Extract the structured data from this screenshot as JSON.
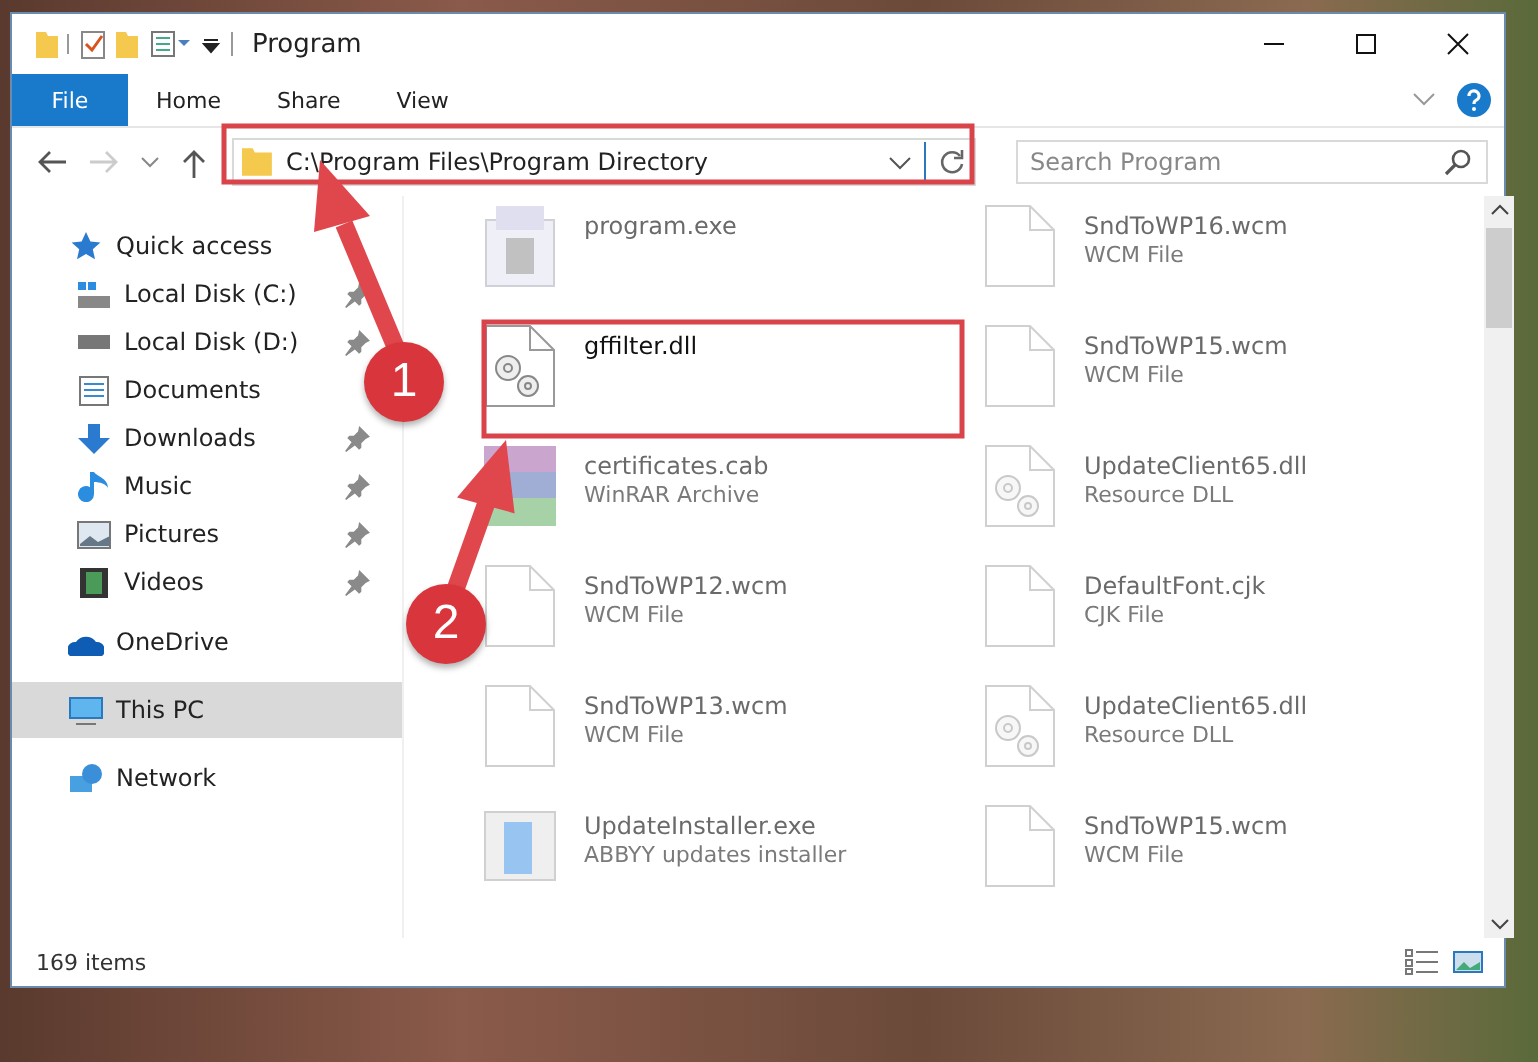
{
  "window": {
    "title": "Program"
  },
  "ribbon": {
    "tabs": [
      {
        "label": "File",
        "kind": "file",
        "selected": false
      },
      {
        "label": "Home",
        "kind": "tab",
        "selected": false
      },
      {
        "label": "Share",
        "kind": "tab",
        "selected": false
      },
      {
        "label": "View",
        "kind": "tab",
        "selected": false
      }
    ]
  },
  "address_bar": {
    "path": "C:\\Program Files\\Program Directory"
  },
  "search": {
    "placeholder": "Search Program"
  },
  "sidebar": {
    "items": [
      {
        "label": "Quick access",
        "selected": false,
        "children": [
          {
            "label": "Local Disk (C:)",
            "pinned": true,
            "selected": false
          },
          {
            "label": "Local Disk (D:)",
            "pinned": true,
            "selected": false
          },
          {
            "label": "Documents",
            "pinned": false,
            "selected": false
          },
          {
            "label": "Downloads",
            "pinned": true,
            "selected": false
          },
          {
            "label": "Music",
            "pinned": true,
            "selected": false
          },
          {
            "label": "Pictures",
            "pinned": true,
            "selected": false
          },
          {
            "label": "Videos",
            "pinned": true,
            "selected": false
          }
        ]
      },
      {
        "label": "OneDrive",
        "selected": false
      },
      {
        "label": "This PC",
        "selected": true
      },
      {
        "label": "Network",
        "selected": false
      }
    ]
  },
  "files": [
    {
      "name": "program.exe",
      "kind": "exe",
      "dimmed": true
    },
    {
      "name": "SndToWP16.wcm",
      "type": "WCM File",
      "kind": "blank",
      "dimmed": true
    },
    {
      "name": "gffilter.dll",
      "kind": "dll",
      "dimmed": false
    },
    {
      "name": "SndToWP15.wcm",
      "type": "WCM File",
      "kind": "blank",
      "dimmed": true
    },
    {
      "name": "certificates.cab",
      "type": "WinRAR Archive",
      "kind": "archive",
      "dimmed": true
    },
    {
      "name": "UpdateClient65.dll",
      "type": "Resource DLL",
      "kind": "dll",
      "dimmed": true
    },
    {
      "name": "SndToWP12.wcm",
      "type": "WCM File",
      "kind": "blank",
      "dimmed": true
    },
    {
      "name": "DefaultFont.cjk",
      "type": "CJK File",
      "kind": "blank",
      "dimmed": true
    },
    {
      "name": "SndToWP13.wcm",
      "type": "WCM File",
      "kind": "blank",
      "dimmed": true
    },
    {
      "name": "UpdateClient65.dll",
      "type": "Resource DLL",
      "kind": "dll",
      "dimmed": true
    },
    {
      "name": "UpdateInstaller.exe",
      "type": "ABBYY updates installer",
      "kind": "installer",
      "dimmed": true
    },
    {
      "name": "SndToWP15.wcm",
      "type": "WCM File",
      "kind": "blank",
      "dimmed": true
    }
  ],
  "status_bar": {
    "item_count": "169 items"
  },
  "annotations": [
    {
      "number": "1"
    },
    {
      "number": "2"
    }
  ]
}
